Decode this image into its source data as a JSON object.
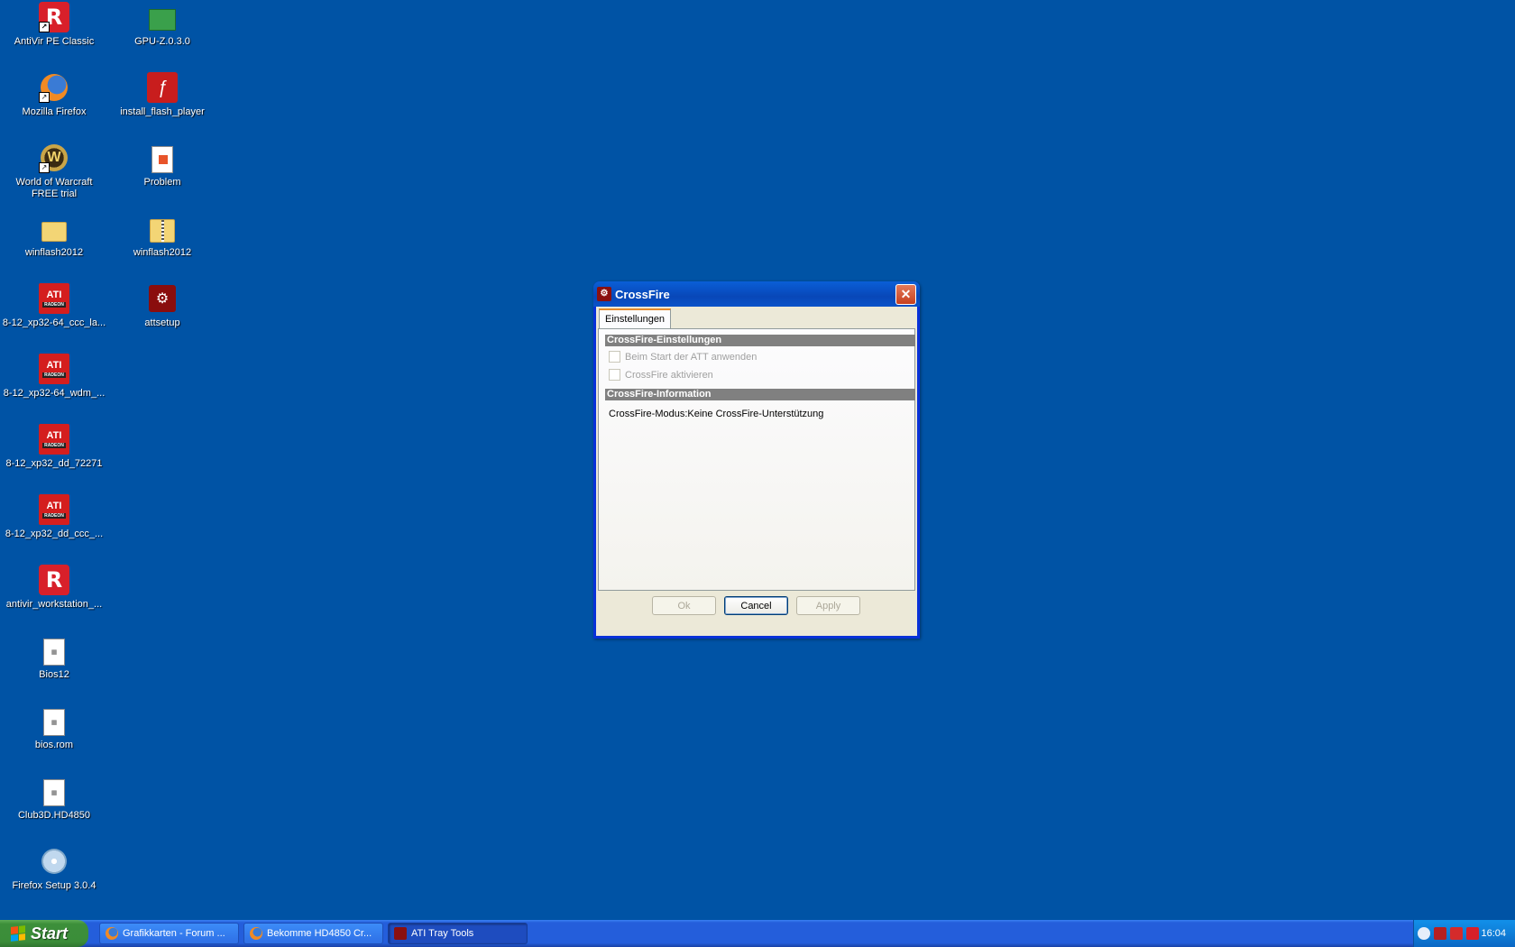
{
  "desktop": {
    "icons": [
      {
        "label": "AntiVir PE Classic",
        "icon": "avira-icon"
      },
      {
        "label": "Mozilla Firefox",
        "icon": "firefox-icon"
      },
      {
        "label": "World of Warcraft FREE trial",
        "icon": "wow-icon"
      },
      {
        "label": "winflash2012",
        "icon": "folder-icon"
      },
      {
        "label": "8-12_xp32-64_ccc_la...",
        "icon": "ati-icon"
      },
      {
        "label": "8-12_xp32-64_wdm_...",
        "icon": "ati-icon"
      },
      {
        "label": "8-12_xp32_dd_72271",
        "icon": "ati-icon"
      },
      {
        "label": "8-12_xp32_dd_ccc_...",
        "icon": "ati-icon"
      },
      {
        "label": "antivir_workstation_...",
        "icon": "avira-icon"
      },
      {
        "label": "Bios12",
        "icon": "rom-file-icon"
      },
      {
        "label": "bios.rom",
        "icon": "rom-file-icon"
      },
      {
        "label": "Club3D.HD4850",
        "icon": "rom-file-icon"
      },
      {
        "label": "Firefox Setup 3.0.4",
        "icon": "setup-icon"
      },
      {
        "label": "GPU-Z.0.3.0",
        "icon": "gpu-card-icon"
      },
      {
        "label": "install_flash_player",
        "icon": "flash-icon"
      },
      {
        "label": "Problem",
        "icon": "image-file-icon"
      },
      {
        "label": "winflash2012",
        "icon": "zip-folder-icon"
      },
      {
        "label": "attsetup",
        "icon": "att-setup-icon"
      }
    ]
  },
  "dialog": {
    "title": "CrossFire",
    "tab": "Einstellungen",
    "section1": "CrossFire-Einstellungen",
    "checkbox1": "Beim Start der ATT anwenden",
    "checkbox2": "CrossFire aktivieren",
    "section2": "CrossFire-Information",
    "info": "CrossFire-Modus:Keine CrossFire-Unterstützung",
    "ok": "Ok",
    "cancel": "Cancel",
    "apply": "Apply"
  },
  "taskbar": {
    "start": "Start",
    "tasks": [
      {
        "label": "Grafikkarten - Forum ...",
        "icon": "firefox-icon"
      },
      {
        "label": "Bekomme HD4850 Cr...",
        "icon": "firefox-icon"
      },
      {
        "label": "ATI Tray Tools",
        "icon": "ati-tray-tools-icon"
      }
    ],
    "clock": "16:04"
  }
}
